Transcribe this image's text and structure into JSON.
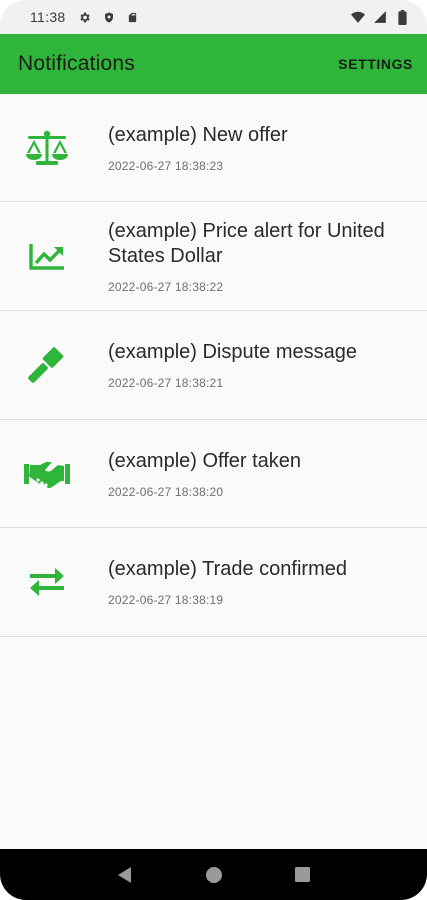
{
  "status_bar": {
    "time": "11:38",
    "left_icons": [
      "gear-icon",
      "shield-icon",
      "sd-card-icon"
    ],
    "right_icons": [
      "wifi-icon",
      "signal-icon",
      "battery-icon"
    ]
  },
  "app_bar": {
    "title": "Notifications",
    "settings_label": "SETTINGS",
    "color": "#2fb63a"
  },
  "notifications": [
    {
      "icon": "scale-icon",
      "label": "(example) New offer",
      "timestamp": "2022-06-27 18:38:23"
    },
    {
      "icon": "trending-up-icon",
      "label": "(example) Price alert for United States Dollar",
      "timestamp": "2022-06-27 18:38:22"
    },
    {
      "icon": "gavel-icon",
      "label": "(example) Dispute message",
      "timestamp": "2022-06-27 18:38:21"
    },
    {
      "icon": "handshake-icon",
      "label": "(example) Offer taken",
      "timestamp": "2022-06-27 18:38:20"
    },
    {
      "icon": "swap-arrows-icon",
      "label": "(example) Trade confirmed",
      "timestamp": "2022-06-27 18:38:19"
    }
  ],
  "icon_color": "#2fb63a",
  "nav_bar": [
    "back-icon",
    "home-icon",
    "recents-icon"
  ]
}
